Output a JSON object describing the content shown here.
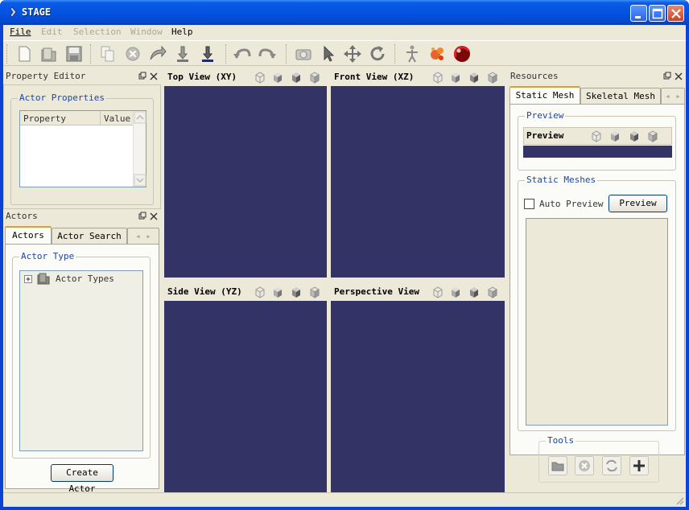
{
  "window": {
    "title": "STAGE"
  },
  "menu": {
    "file": "File",
    "edit": "Edit",
    "selection": "Selection",
    "window": "Window",
    "help": "Help"
  },
  "toolbar": {
    "icons": [
      "new-file-icon",
      "open-folder-icon",
      "save-icon",
      "copy-icon",
      "delete-icon",
      "import-icon",
      "export-down-icon",
      "export-down-dark-icon",
      "undo-icon",
      "redo-icon",
      "camera-icon",
      "pointer-icon",
      "move-icon",
      "rotate-icon",
      "actor-figure-icon",
      "particle-icon",
      "sphere-icon"
    ]
  },
  "property_editor": {
    "title": "Property Editor",
    "group": "Actor Properties",
    "columns": [
      "Property",
      "Value"
    ]
  },
  "actors_panel": {
    "title": "Actors",
    "tabs": [
      "Actors",
      "Actor Search"
    ],
    "group": "Actor Type",
    "tree_root": "Actor Types",
    "create_button": "Create Actor"
  },
  "viewports": {
    "top": "Top View (XY)",
    "front": "Front View (XZ)",
    "side": "Side View (YZ)",
    "perspective": "Perspective View",
    "bg_color": "#333366"
  },
  "resources": {
    "title": "Resources",
    "tabs": [
      "Static Mesh",
      "Skeletal Mesh"
    ],
    "preview_group": "Preview",
    "preview_title": "Preview",
    "static_meshes_group": "Static Meshes",
    "auto_preview_label": "Auto Preview",
    "preview_button": "Preview",
    "tools_group": "Tools"
  }
}
